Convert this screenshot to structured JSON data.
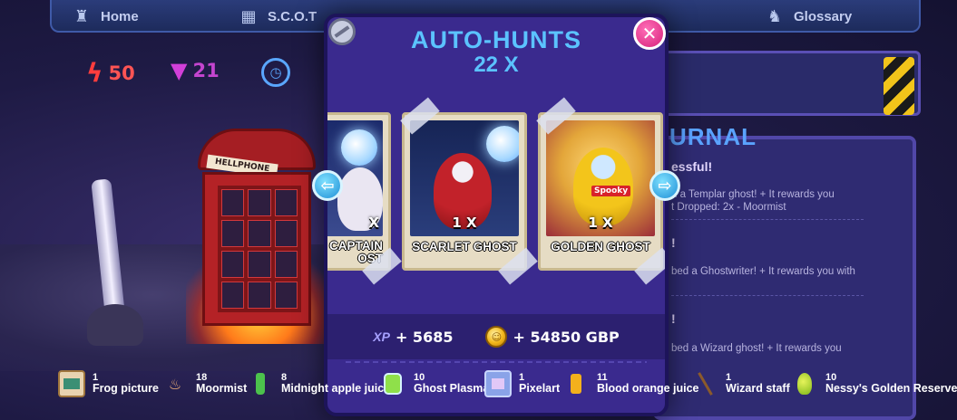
{
  "nav": {
    "home_label": "Home",
    "scot_label": "S.C.O.T",
    "glossary_label": "Glossary"
  },
  "stats": {
    "energy": "50",
    "eye": "21"
  },
  "scene": {
    "booth_sign": "HELLPHONE"
  },
  "journal": {
    "title": "URNAL",
    "lines": [
      "essful!",
      "d a Templar ghost! + It rewards you",
      "t Dropped: 2x - Moormist",
      "bed a Ghostwriter! + It rewards you with",
      "bed a Wizard ghost! + It rewards you"
    ],
    "heads": [
      "!",
      "!"
    ]
  },
  "modal": {
    "title": "AUTO-HUNTS",
    "count": "22 X",
    "cards": [
      {
        "qty": "X",
        "name": "CAPTAIN",
        "name2": "OST"
      },
      {
        "qty": "1 X",
        "name": "SCARLET GHOST"
      },
      {
        "qty": "1 X",
        "name": "GOLDEN GHOST",
        "tag": "Spooky"
      }
    ],
    "xp_label": "XP",
    "xp_value": "+ 5685",
    "gbp_value": "+ 54850 GBP"
  },
  "inventory": [
    {
      "count": "1",
      "name": "Frog picture",
      "icon": "frog-picture-icon"
    },
    {
      "count": "18",
      "name": "Moormist",
      "icon": "moormist-icon"
    },
    {
      "count": "8",
      "name": "Midnight apple juice",
      "icon": "bottle-icon"
    },
    {
      "count": "10",
      "name": "Ghost Plasma",
      "icon": "plasma-jar-icon"
    },
    {
      "count": "1",
      "name": "Pixelart",
      "icon": "pixelart-icon"
    },
    {
      "count": "11",
      "name": "Blood orange juice",
      "icon": "juice-icon"
    },
    {
      "count": "1",
      "name": "Wizard staff",
      "icon": "staff-icon"
    },
    {
      "count": "10",
      "name": "Nessy's Golden Reserve",
      "icon": "golden-bottle-icon"
    }
  ],
  "colors": {
    "accent": "#5bc3ff",
    "modal_bg": "#3a2a8e",
    "close": "#d61f7a",
    "energy": "#ff5454",
    "eye": "#c445cf"
  }
}
